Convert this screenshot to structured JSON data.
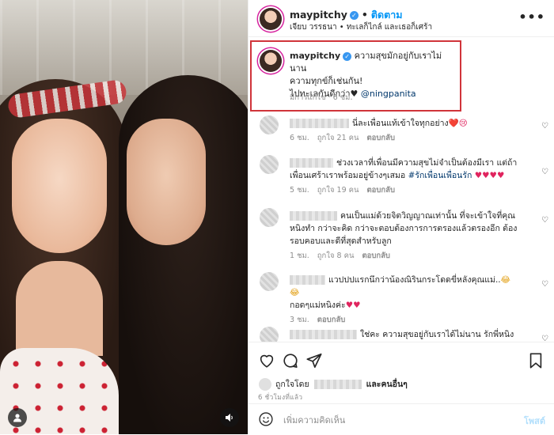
{
  "post": {
    "username": "maypitchy",
    "follow_label": "ติดตาม",
    "subtitle": "เจียบ วรรธนา • ทะเลก็ไกล์ และเธอก็เศร้า",
    "more_label": "•••"
  },
  "caption": {
    "username": "maypitchy",
    "line1": "ความสุขมักอยู่กับเราไม่นาน",
    "line2": "ความทุกข์ก็เช่นกัน!",
    "line3": "ไปทะเลกันดีกว่า♥",
    "mention": "@ningpanita",
    "edited": "มีการแก้ไข",
    "time": "6 ชม."
  },
  "comments": [
    {
      "text": "นี่ละเพื่อนแท้เข้าใจทุกอย่าง",
      "emoji": "❤️😢",
      "time": "6 ชม.",
      "likes": "ถูกใจ 21 คน",
      "reply": "ตอบกลับ"
    },
    {
      "text": "ช่วงเวลาที่เพื่อนมีความสุขไม่จำเป็นต้องมีเรา แต่ถ้าเพื่อนเศร้าเราพร้อมอยู่ข้างๆเสมอ",
      "tag": "#รักเพื่อนเพื่อนรัก",
      "emoji": "♥♥♥♥",
      "time": "5 ชม.",
      "likes": "ถูกใจ 19 คน",
      "reply": "ตอบกลับ"
    },
    {
      "text": "คนเป็นแม่ด้วยจิตวิญญาณเท่านั้น ที่จะเข้าใจที่คุณหนิงทำ กว่าจะคิด กว่าจะตอบต้องการการตรองแล้วตรองอีก ต้องรอบคอบและดีที่สุดสำหรับลูก",
      "time": "1 ชม.",
      "likes": "ถูกใจ 8 คน",
      "reply": "ตอบกลับ"
    },
    {
      "text": "แวปปปแรกนึกว่าน้องณิรินกระโดดขี่หลังคุณแม่..",
      "text2": "กอดๆแม่หนิงค่ะ",
      "emoji": "😂😂",
      "emoji2": "♥♥",
      "time": "3 ชม.",
      "reply": "ตอบกลับ"
    },
    {
      "text": "ใช่คะ ความสุขอยู่กับเราได้ไม่นาน รักพี่หนิง กอด"
    }
  ],
  "footer": {
    "liked_by": "ถูกใจโดย",
    "and_others": "และคนอื่นๆ",
    "time_ago": "6 ชั่วโมงที่แล้ว",
    "comment_placeholder": "เพิ่มความคิดเห็น",
    "post_label": "โพสต์"
  },
  "colors": {
    "accent": "#0095f6",
    "highlight_border": "#d0343a",
    "heart": "#e0245e"
  },
  "icons": [
    "heart-icon",
    "comment-icon",
    "share-icon",
    "bookmark-icon",
    "emoji-icon",
    "user-icon",
    "sound-icon",
    "verified-icon"
  ]
}
